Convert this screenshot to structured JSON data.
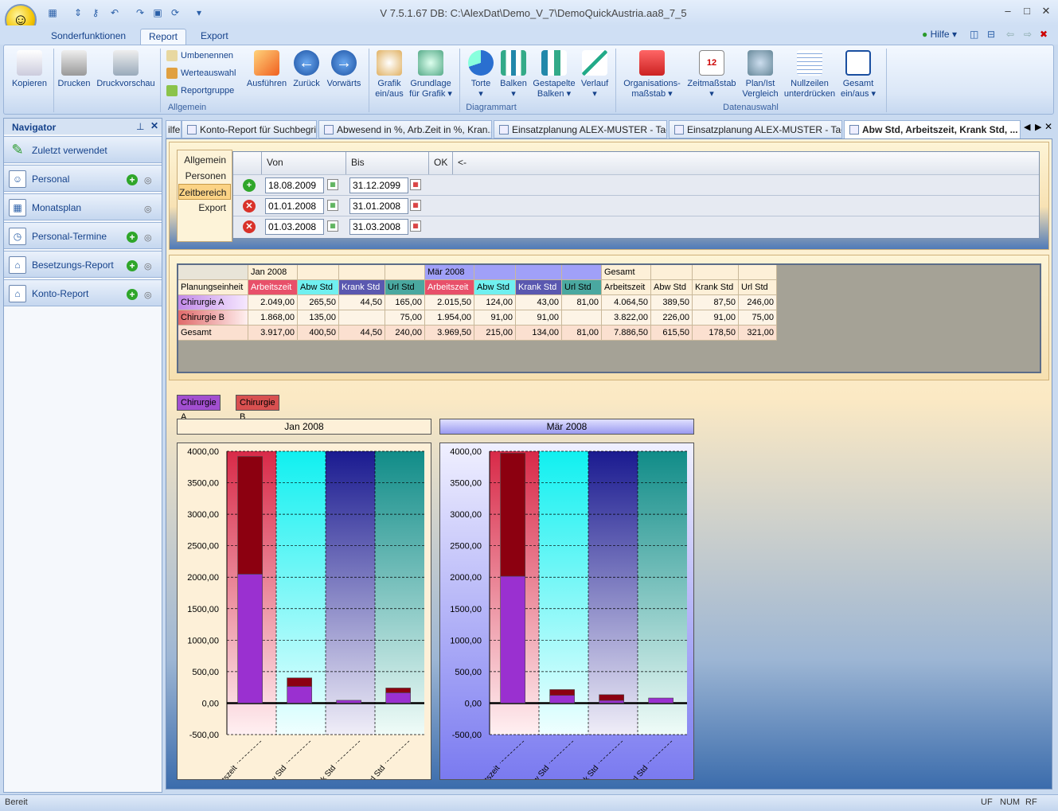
{
  "window": {
    "title": "V 7.5.1.67 DB: C:\\AlexDat\\Demo_V_7\\DemoQuickAustria.aa8_7_5",
    "help_label": "Hilfe"
  },
  "ribbon_tabs": [
    "Sonderfunktionen",
    "Report",
    "Export"
  ],
  "ribbon": {
    "btn_kopieren": "Kopieren",
    "btn_drucken": "Drucken",
    "btn_druckvorschau": "Druckvorschau",
    "btn_umbenennen": "Umbenennen",
    "btn_werteauswahl": "Werteauswahl",
    "btn_reportgruppe": "Reportgruppe",
    "btn_ausfuehren": "Ausführen",
    "btn_zurueck": "Zurück",
    "btn_vorwaerts": "Vorwärts",
    "group_allgemein": "Allgemein",
    "btn_grafik_1": "Grafik",
    "btn_grafik_2": "ein/aus",
    "btn_grundlage_1": "Grundlage",
    "btn_grundlage_2": "für Grafik",
    "btn_torte": "Torte",
    "btn_balken": "Balken",
    "btn_gest_1": "Gestapelte",
    "btn_gest_2": "Balken",
    "btn_verlauf": "Verlauf",
    "group_diagrammart": "Diagrammart",
    "btn_org_1": "Organisations-",
    "btn_org_2": "maßstab",
    "btn_zeit": "Zeitmaßstab",
    "btn_plan_1": "Plan/Ist",
    "btn_plan_2": "Vergleich",
    "btn_null_1": "Nullzeilen",
    "btn_null_2": "unterdrücken",
    "btn_ges_1": "Gesamt",
    "btn_ges_2": "ein/aus",
    "group_datenauswahl": "Datenauswahl"
  },
  "navigator": {
    "title": "Navigator",
    "items": [
      "Zuletzt verwendet",
      "Personal",
      "Monatsplan",
      "Personal-Termine",
      "Besetzungs-Report",
      "Konto-Report"
    ]
  },
  "doc_tabs": [
    "ilfe",
    "Konto-Report für Suchbegriff",
    "Abwesend in %, Arb.Zeit in %, Kran...",
    "Einsatzplanung ALEX-MUSTER - Tag...",
    "Einsatzplanung ALEX-MUSTER - Tag...",
    "Abw Std, Arbeitszeit, Krank Std, ..."
  ],
  "filter": {
    "tabs": [
      "Allgemein",
      "Personen",
      "Zeitbereich",
      "Export"
    ],
    "headers": [
      "Von",
      "Bis",
      "OK",
      "<-"
    ],
    "rows": [
      {
        "von": "18.08.2009",
        "bis": "31.12.2099"
      },
      {
        "von": "01.01.2008",
        "bis": "31.01.2008"
      },
      {
        "von": "01.03.2008",
        "bis": "31.03.2008"
      }
    ]
  },
  "table": {
    "groups": [
      "Jan 2008",
      "Mär 2008",
      "Gesamt"
    ],
    "row_header": "Planungseinheit",
    "columns": [
      "Arbeitszeit",
      "Abw Std",
      "Krank Std",
      "Url Std"
    ],
    "rows": [
      {
        "name": "Chirurgie A",
        "values": [
          "2.049,00",
          "265,50",
          "44,50",
          "165,00",
          "2.015,50",
          "124,00",
          "43,00",
          "81,00",
          "4.064,50",
          "389,50",
          "87,50",
          "246,00"
        ]
      },
      {
        "name": "Chirurgie B",
        "values": [
          "1.868,00",
          "135,00",
          "",
          "75,00",
          "1.954,00",
          "91,00",
          "91,00",
          "",
          "3.822,00",
          "226,00",
          "91,00",
          "75,00"
        ]
      },
      {
        "name": "Gesamt",
        "values": [
          "3.917,00",
          "400,50",
          "44,50",
          "240,00",
          "3.969,50",
          "215,00",
          "134,00",
          "81,00",
          "7.886,50",
          "615,50",
          "178,50",
          "321,00"
        ]
      }
    ]
  },
  "chart_data": [
    {
      "type": "bar",
      "stacked": true,
      "title": "Jan 2008",
      "categories": [
        "Arbeitszeit",
        "Abw Std",
        "Krank Std",
        "Url Std"
      ],
      "series": [
        {
          "name": "Chirurgie A",
          "values": [
            2049,
            265.5,
            44.5,
            165
          ]
        },
        {
          "name": "Chirurgie B",
          "values": [
            1868,
            135,
            0,
            75
          ]
        }
      ],
      "ylim": [
        -500,
        4000
      ],
      "yticks": [
        "4000,00",
        "3500,00",
        "3000,00",
        "2500,00",
        "2000,00",
        "1500,00",
        "1000,00",
        "500,00",
        "0,00",
        "-500,00"
      ],
      "grid": true,
      "legend": "top-left"
    },
    {
      "type": "bar",
      "stacked": true,
      "title": "Mär 2008",
      "categories": [
        "Arbeitszeit",
        "Abw Std",
        "Krank Std",
        "Url Std"
      ],
      "series": [
        {
          "name": "Chirurgie A",
          "values": [
            2015.5,
            124,
            43,
            81
          ]
        },
        {
          "name": "Chirurgie B",
          "values": [
            1954,
            91,
            91,
            0
          ]
        }
      ],
      "ylim": [
        -500,
        4000
      ],
      "yticks": [
        "4000,00",
        "3500,00",
        "3000,00",
        "2500,00",
        "2000,00",
        "1500,00",
        "1000,00",
        "500,00",
        "0,00",
        "-500,00"
      ],
      "grid": true,
      "legend": "top-left"
    }
  ],
  "status": {
    "left": "Bereit",
    "uf": "UF",
    "num": "NUM",
    "rf": "RF"
  }
}
